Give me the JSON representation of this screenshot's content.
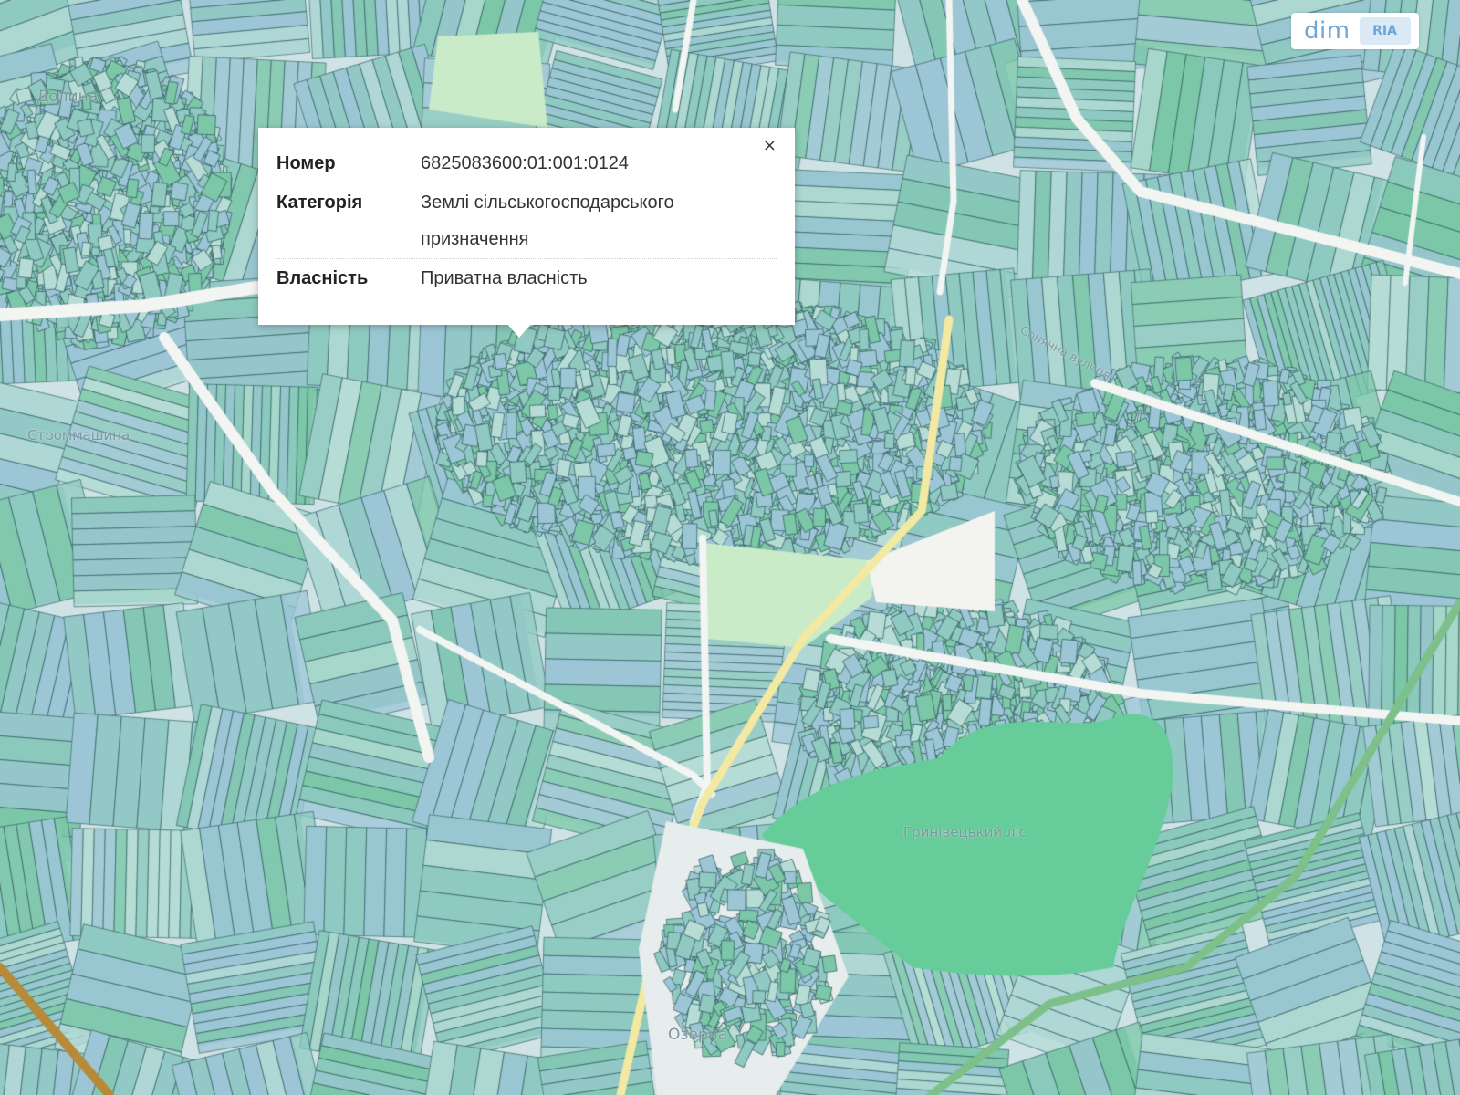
{
  "map": {
    "colors": {
      "background": "#cfe3e6",
      "parcel_teal": "#8fc9c1",
      "parcel_blue": "#9cc6d6",
      "parcel_green": "#7cc7a8",
      "parcel_light": "#b6dcd5",
      "parcel_stroke": "#2f5a5c",
      "road": "#f3f5f3",
      "road_major": "#f2e9a3",
      "forest": "#66cc99",
      "field_light": "#c9ebc8"
    },
    "labels": [
      "Долина",
      "Строммашина",
      "Озерна",
      "Гринівецький ліс",
      "Сонячна вулиця"
    ]
  },
  "popup": {
    "close_label": "×",
    "rows": [
      {
        "key": "Номер",
        "value": "6825083600:01:001:0124"
      },
      {
        "key": "Категорія",
        "value": "Землі сільськогосподарського призначення"
      },
      {
        "key": "Власність",
        "value": "Приватна власність"
      }
    ]
  },
  "watermark": {
    "text": "dim",
    "badge": "RIA"
  }
}
